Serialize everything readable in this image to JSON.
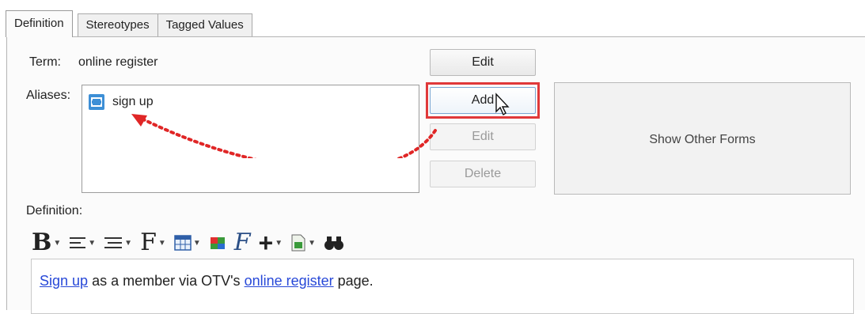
{
  "tabs": [
    {
      "label": "Definition",
      "active": true
    },
    {
      "label": "Stereotypes",
      "active": false
    },
    {
      "label": "Tagged Values",
      "active": false
    }
  ],
  "term": {
    "label": "Term:",
    "value": "online register",
    "edit_button": "Edit"
  },
  "aliases": {
    "label": "Aliases:",
    "items": [
      {
        "icon": "alias-icon",
        "text": "sign up"
      }
    ],
    "buttons": {
      "add": "Add",
      "edit": "Edit",
      "delete": "Delete"
    }
  },
  "other_forms_button": "Show Other Forms",
  "definition": {
    "label": "Definition:",
    "toolbar": [
      {
        "name": "bold-icon",
        "has_dropdown": true
      },
      {
        "name": "align-icon",
        "has_dropdown": true
      },
      {
        "name": "list-icon",
        "has_dropdown": true
      },
      {
        "name": "font-icon",
        "has_dropdown": true
      },
      {
        "name": "table-icon",
        "has_dropdown": true
      },
      {
        "name": "color-icon",
        "has_dropdown": false
      },
      {
        "name": "format-icon",
        "has_dropdown": false
      },
      {
        "name": "insert-icon",
        "has_dropdown": true
      },
      {
        "name": "image-icon",
        "has_dropdown": true
      },
      {
        "name": "find-icon",
        "has_dropdown": false
      }
    ],
    "text": {
      "link1": "Sign up",
      "middle": " as a member via OTV's ",
      "link2": "online register",
      "end": " page."
    }
  },
  "colors": {
    "highlight": "#e0393a",
    "arrow": "#e02626",
    "link": "#2748d8"
  }
}
